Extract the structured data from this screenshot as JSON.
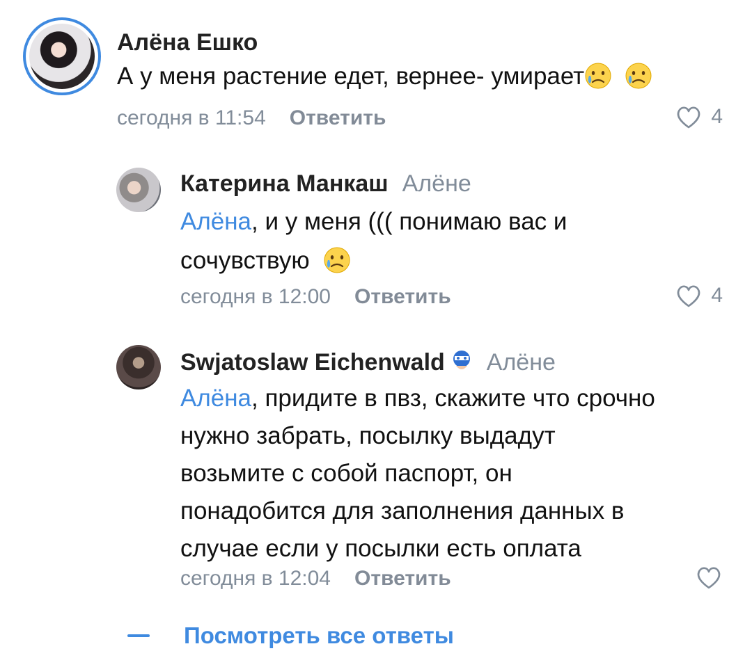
{
  "comments": [
    {
      "author": "Алёна Ешко",
      "text": "А у меня растение едет, вернее- умирает",
      "time": "сегодня в 11:54",
      "reply_label": "Ответить",
      "likes": "4"
    },
    {
      "author": "Катерина Манкаш",
      "reply_to": "Алёне",
      "mention": "Алёна",
      "text_line1": ", и у меня ((( понимаю вас и",
      "text_line2": "сочувствую",
      "time": "сегодня в 12:00",
      "reply_label": "Ответить",
      "likes": "4"
    },
    {
      "author": "Swjatoslaw Eichenwald",
      "reply_to": "Алёне",
      "mention": "Алёна",
      "text_line1": ", придите в пвз, скажите что срочно",
      "text_line2": "нужно забрать, посылку выдадут",
      "text_line3": "возьмите с собой паспорт, он",
      "text_line4": "понадобится для заполнения данных в",
      "text_line5": "случае если у посылки есть оплата",
      "time": "сегодня в 12:04",
      "reply_label": "Ответить"
    }
  ],
  "show_all_label": "Посмотреть все ответы",
  "icons": {
    "like": "heart-outline-icon",
    "sad": "sad-face-emoji",
    "crying": "crying-face-emoji",
    "badge": "captain-badge-icon"
  },
  "colors": {
    "accent": "#3f8ae0",
    "secondary": "#818c99",
    "text": "#111111"
  }
}
